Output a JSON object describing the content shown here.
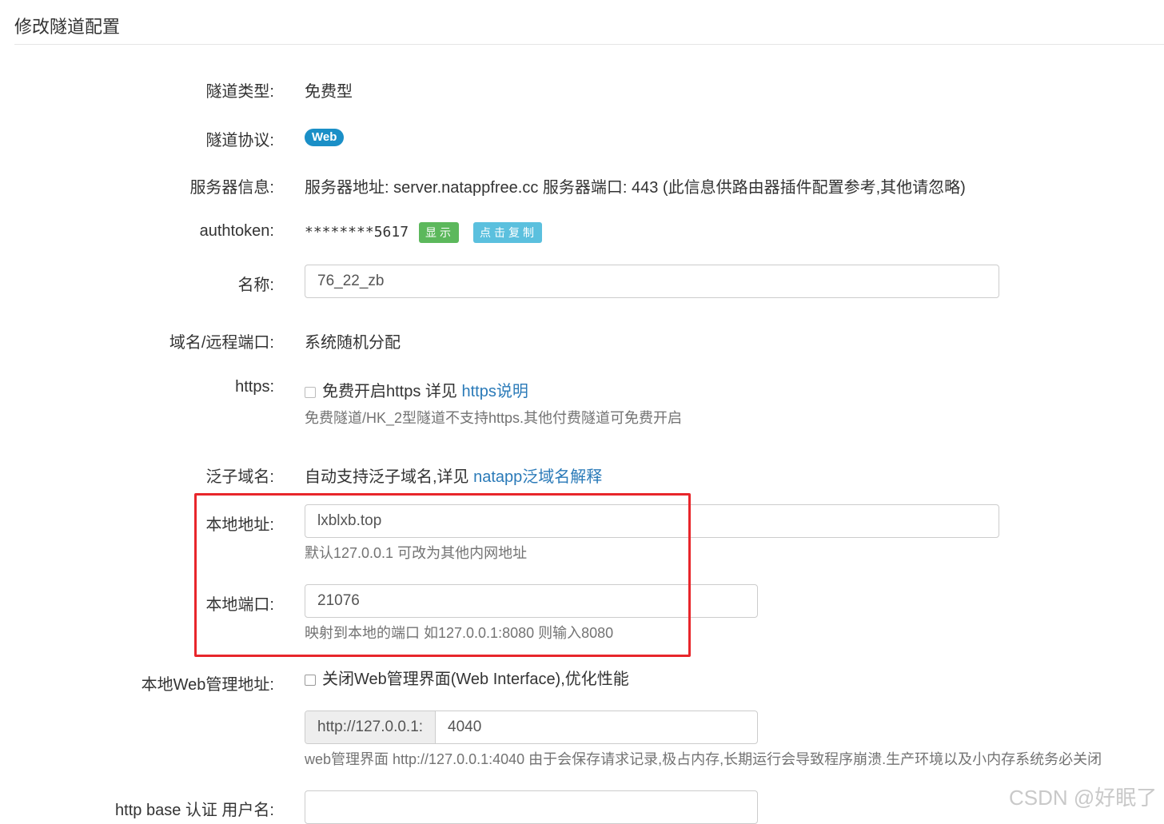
{
  "page": {
    "title": "修改隧道配置"
  },
  "tunnel_type": {
    "label": "隧道类型:",
    "value": "免费型"
  },
  "protocol": {
    "label": "隧道协议:",
    "badge": "Web"
  },
  "server_info": {
    "label": "服务器信息:",
    "value": "服务器地址: server.natappfree.cc 服务器端口: 443 (此信息供路由器插件配置参考,其他请忽略)"
  },
  "authtoken": {
    "label": "authtoken:",
    "masked": "********5617",
    "show_button": "显示",
    "copy_button": "点击复制"
  },
  "name": {
    "label": "名称:",
    "value": "76_22_zb"
  },
  "domain_port": {
    "label": "域名/远程端口:",
    "value": "系统随机分配"
  },
  "https": {
    "label": "https:",
    "checkbox_text": "免费开启https 详见 ",
    "link": "https说明",
    "help": "免费隧道/HK_2型隧道不支持https.其他付费隧道可免费开启"
  },
  "wildcard": {
    "label": "泛子域名:",
    "text": "自动支持泛子域名,详见 ",
    "link": "natapp泛域名解释"
  },
  "local_address": {
    "label": "本地地址:",
    "value": "lxblxb.top",
    "help": "默认127.0.0.1 可改为其他内网地址"
  },
  "local_port": {
    "label": "本地端口:",
    "value": "21076",
    "help": "映射到本地的端口 如127.0.0.1:8080 则输入8080"
  },
  "web_admin": {
    "label": "本地Web管理地址:",
    "checkbox_text": "关闭Web管理界面(Web Interface),优化性能",
    "prefix": "http://127.0.0.1:",
    "port": "4040",
    "help": "web管理界面 http://127.0.0.1:4040 由于会保存请求记录,极占内存,长期运行会导致程序崩溃.生产环境以及小内存系统务必关闭"
  },
  "http_auth": {
    "label": "http base 认证 用户名:",
    "value": ""
  },
  "watermark": "CSDN @好眠了",
  "colors": {
    "badge": "#1a8fc7",
    "show_btn": "#5cb85c",
    "copy_btn": "#5bc0de",
    "link": "#2a7ab8",
    "highlight": "#e8262b"
  }
}
